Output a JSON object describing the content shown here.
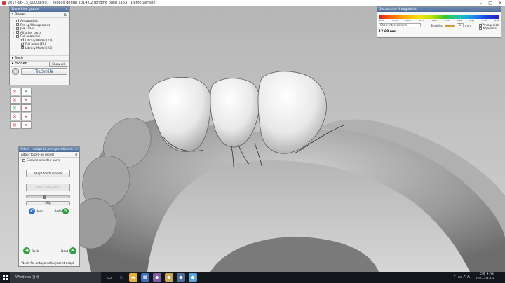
{
  "window": {
    "title": "2017-06-15_00003-001 - exocad dental 2014.02 [Engine build 5163] [Demo Version]",
    "controls": [
      "–",
      "□",
      "✕"
    ]
  },
  "groups_panel": {
    "title": "Show/hide groups",
    "close": "✕",
    "groups_label": "Groups",
    "help": "?",
    "items": [
      {
        "label": "Antagonists",
        "checked": true,
        "level": 0
      },
      {
        "label": "Pre-op/Waxup scans",
        "checked": false,
        "level": 0
      },
      {
        "label": "Jaw scans",
        "checked": true,
        "level": 0
      },
      {
        "label": "All other parts",
        "checked": true,
        "level": 0
      },
      {
        "label": "Full anatomic",
        "checked": true,
        "level": 0
      },
      {
        "label": "Library Model (21)",
        "checked": true,
        "level": 1
      },
      {
        "label": "Full parts (22)",
        "checked": true,
        "level": 1
      },
      {
        "label": "Library Model (23)",
        "checked": true,
        "level": 1
      }
    ],
    "teeth_label": "Teeth",
    "hidden_label": "Hidden",
    "show_all": "Show all",
    "trusmile_label": "TruSmile"
  },
  "adapt_panel": {
    "title": "Adapt - Adapt to pre-operative m...",
    "close": "✕",
    "subtitle": "Adapt to pre-op model",
    "help": "?",
    "exclude_label": "Exclude selected parts",
    "adapt_tooth_models": "Adapt tooth models",
    "adapt_connectors": "Adapt connectors",
    "slider_fraction": 0.4,
    "skip": "Skip",
    "undo": "Undo",
    "redo": "Redo",
    "back": "Back",
    "next": "Next",
    "hint": "'Next' for antagonist/adjacent adapt"
  },
  "distance_panel": {
    "title": "Distance to Antagonists",
    "scale_labels": [
      "-0.65",
      "-0.45",
      "-0.35",
      "-0.15",
      "0.00",
      "0.10",
      "0.20",
      "0.30",
      "0.50",
      "0.60"
    ],
    "dropdown": "Show intersections",
    "studding_label": "Studding",
    "studding_value": "1",
    "unit": "mm",
    "antagonists": "Antagonists",
    "adjacents": "Adjacents",
    "value": "17.68 mm"
  },
  "taskbar": {
    "search_placeholder": "Windows 검색",
    "time": "오후 4:04",
    "date": "2017-07-13"
  }
}
